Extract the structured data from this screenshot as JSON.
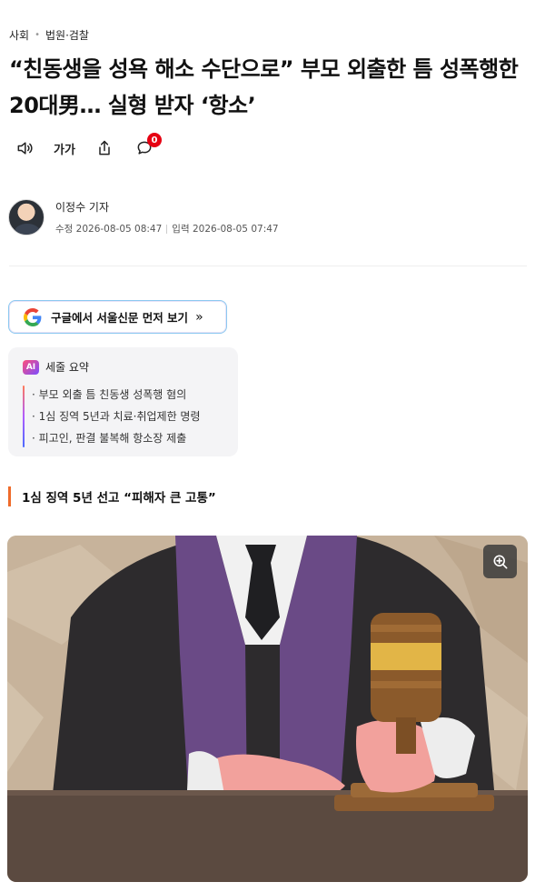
{
  "breadcrumb": {
    "section": "사회",
    "subsection": "법원·검찰"
  },
  "headline": "“친동생을 성욕 해소 수단으로” 부모 외출한 틈 성폭행한 20대男… 실형 받자 ‘항소’",
  "toolbar": {
    "tts_icon": "speaker-icon",
    "font_label": "가가",
    "share_icon": "share-icon",
    "comment_icon": "comment-icon",
    "comment_count": "0"
  },
  "author": {
    "name": "이정수 기자",
    "modified_label": "수정",
    "modified": "2026-08-05 08:47",
    "published_label": "입력",
    "published": "2026-08-05 07:47"
  },
  "google_promo": {
    "label": "구글에서 서울신문 먼저 보기",
    "arrow": "»"
  },
  "ai_summary": {
    "tag": "AI",
    "title": "세줄 요약",
    "items": [
      "부모 외출 틈 친동생 성폭행 혐의",
      "1심 징역 5년과 치료·취업제한 명령",
      "피고인, 판결 불복해 항소장 제출"
    ]
  },
  "subheading": "1심 징역 5년 선고 “피해자 큰 고통”",
  "photo": {
    "zoom_icon": "zoom-in-icon"
  },
  "colors": {
    "accent": "#ef6b2a",
    "badge": "#e60012",
    "promo_border": "#8cc9f0"
  }
}
